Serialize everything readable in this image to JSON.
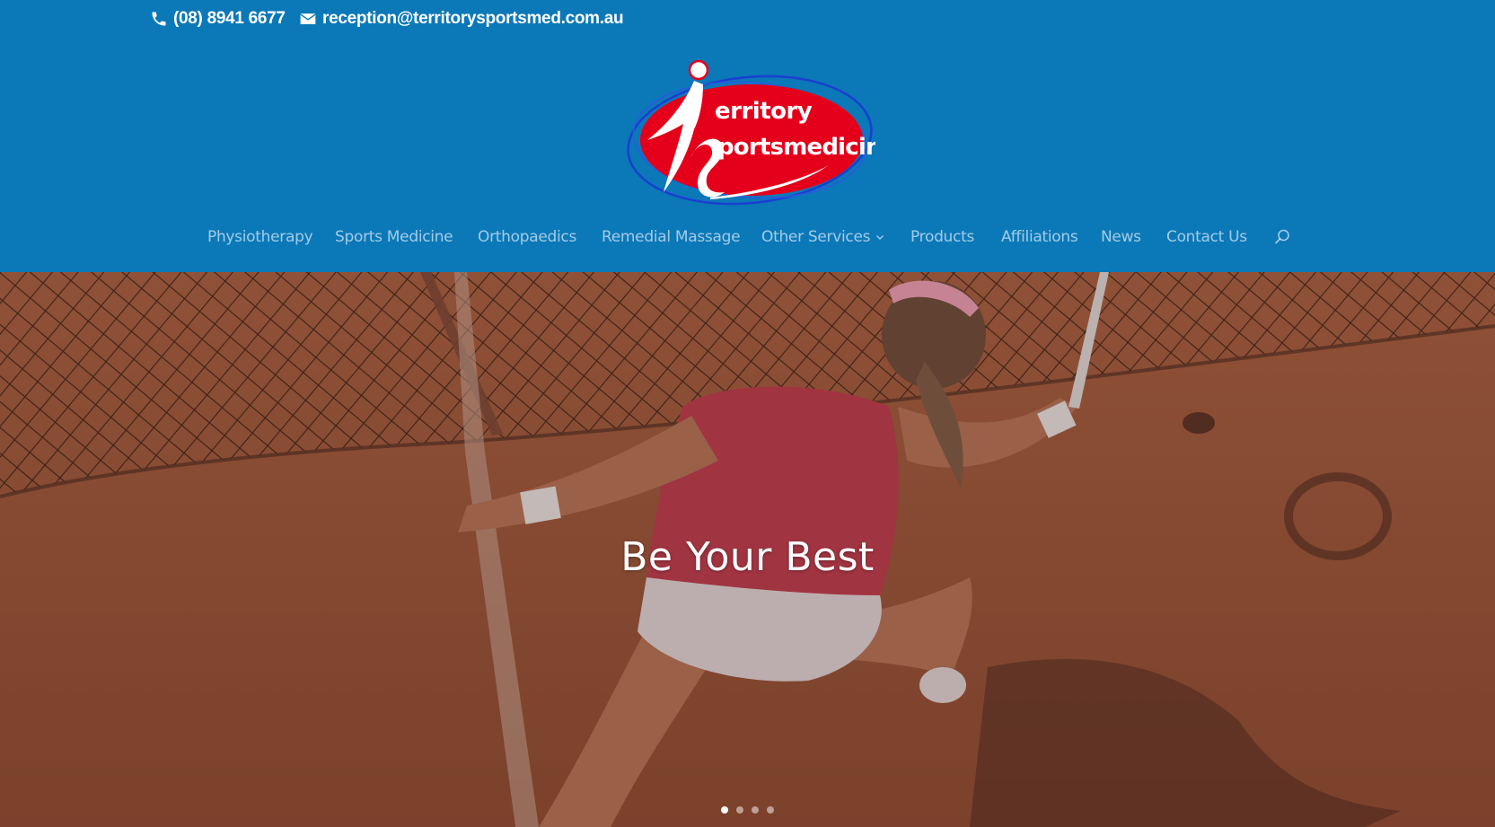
{
  "topbar": {
    "phone": {
      "icon": "phone-icon",
      "text": "(08) 8941 6677"
    },
    "email": {
      "icon": "mail-icon",
      "text": "reception@territorysportsmed.com.au"
    }
  },
  "logo": {
    "line1": "erritory",
    "line2": "portsmedicine",
    "colors": {
      "ellipse": "#e4001b",
      "ring": "#1a3fd0",
      "text": "#ffffff"
    }
  },
  "nav": {
    "items": [
      {
        "label": "Physiotherapy"
      },
      {
        "label": "Sports Medicine"
      },
      {
        "label": "Orthopaedics"
      },
      {
        "label": "Remedial Massage"
      },
      {
        "label": "Other Services",
        "has_dropdown": true
      },
      {
        "label": "Products"
      },
      {
        "label": "Affiliations"
      },
      {
        "label": "News"
      },
      {
        "label": "Contact Us"
      }
    ],
    "search_icon": "search-icon"
  },
  "hero": {
    "title": "Be Your Best",
    "slides_total": 4,
    "active_slide": 1
  },
  "colors": {
    "brand_blue": "#0b78b8",
    "nav_text": "rgba(255,255,255,0.62)",
    "hero_overlay": "#8e4d34"
  }
}
